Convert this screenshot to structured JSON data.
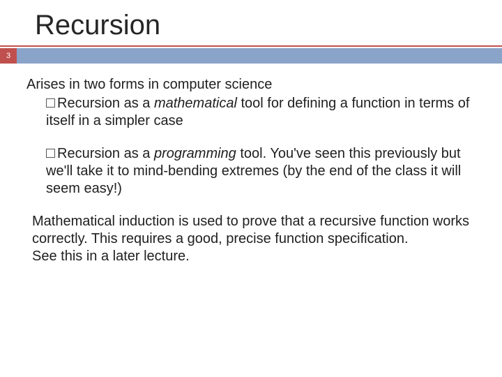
{
  "slide": {
    "title": "Recursion",
    "pageNumber": "3",
    "intro": "Arises in two forms in computer science",
    "bullets": [
      {
        "prefix": "Recursion as a ",
        "emphasis": "mathematical",
        "suffix": " tool for defining a function in terms of itself in a simpler case"
      },
      {
        "prefix": "Recursion as a ",
        "emphasis": "programming",
        "suffix": " tool. You've seen this previously but we'll take it to mind-bending extremes (by the end of the class it will seem easy!)"
      }
    ],
    "closing1": "Mathematical induction is used to prove that a recursive function works correctly. This requires a good, precise function specification.",
    "closing2": "See this in a later lecture."
  }
}
